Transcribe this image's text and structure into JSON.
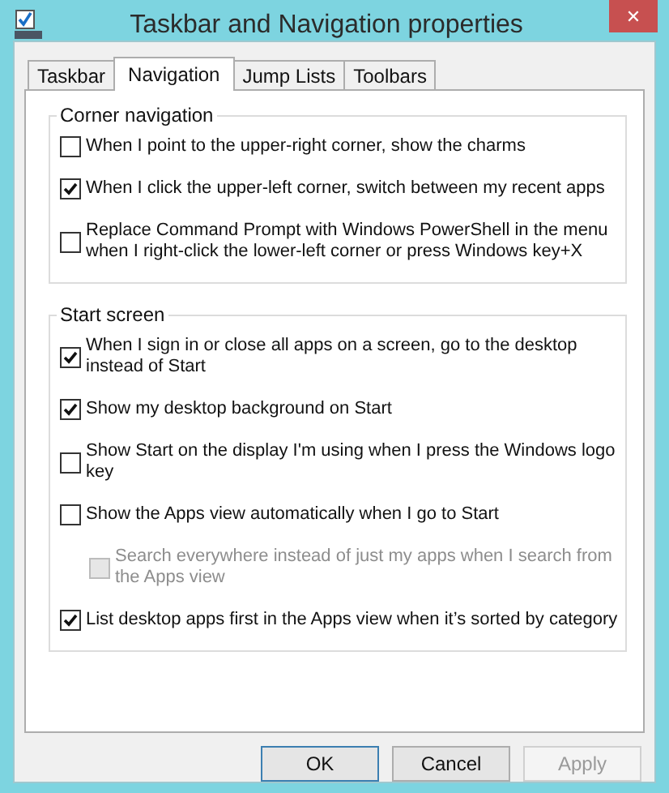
{
  "window": {
    "title": "Taskbar and Navigation properties",
    "close": "✕"
  },
  "tabs": [
    {
      "label": "Taskbar",
      "selected": false
    },
    {
      "label": "Navigation",
      "selected": true
    },
    {
      "label": "Jump Lists",
      "selected": false
    },
    {
      "label": "Toolbars",
      "selected": false
    }
  ],
  "groups": [
    {
      "title": "Corner navigation",
      "items": [
        {
          "label": "When I point to the upper-right corner, show the charms",
          "checked": false,
          "disabled": false
        },
        {
          "label": "When I click the upper-left corner, switch between my recent apps",
          "checked": true,
          "disabled": false
        },
        {
          "label": "Replace Command Prompt with Windows PowerShell in the menu when I right-click the lower-left corner or press Windows key+X",
          "checked": false,
          "disabled": false
        }
      ]
    },
    {
      "title": "Start screen",
      "items": [
        {
          "label": "When I sign in or close all apps on a screen, go to the desktop instead of Start",
          "checked": true,
          "disabled": false
        },
        {
          "label": "Show my desktop background on Start",
          "checked": true,
          "disabled": false
        },
        {
          "label": "Show Start on the display I'm using when I press the Windows logo key",
          "checked": false,
          "disabled": false
        },
        {
          "label": "Show the Apps view automatically when I go to Start",
          "checked": false,
          "disabled": false,
          "children": [
            {
              "label": "Search everywhere instead of just my apps when I search from the Apps view",
              "checked": false,
              "disabled": true
            }
          ]
        },
        {
          "label": "List desktop apps first in the Apps view when it’s sorted by category",
          "checked": true,
          "disabled": false
        }
      ]
    }
  ],
  "buttons": [
    {
      "label": "OK",
      "disabled": false,
      "default": true
    },
    {
      "label": "Cancel",
      "disabled": false,
      "default": false
    },
    {
      "label": "Apply",
      "disabled": true,
      "default": false
    }
  ]
}
